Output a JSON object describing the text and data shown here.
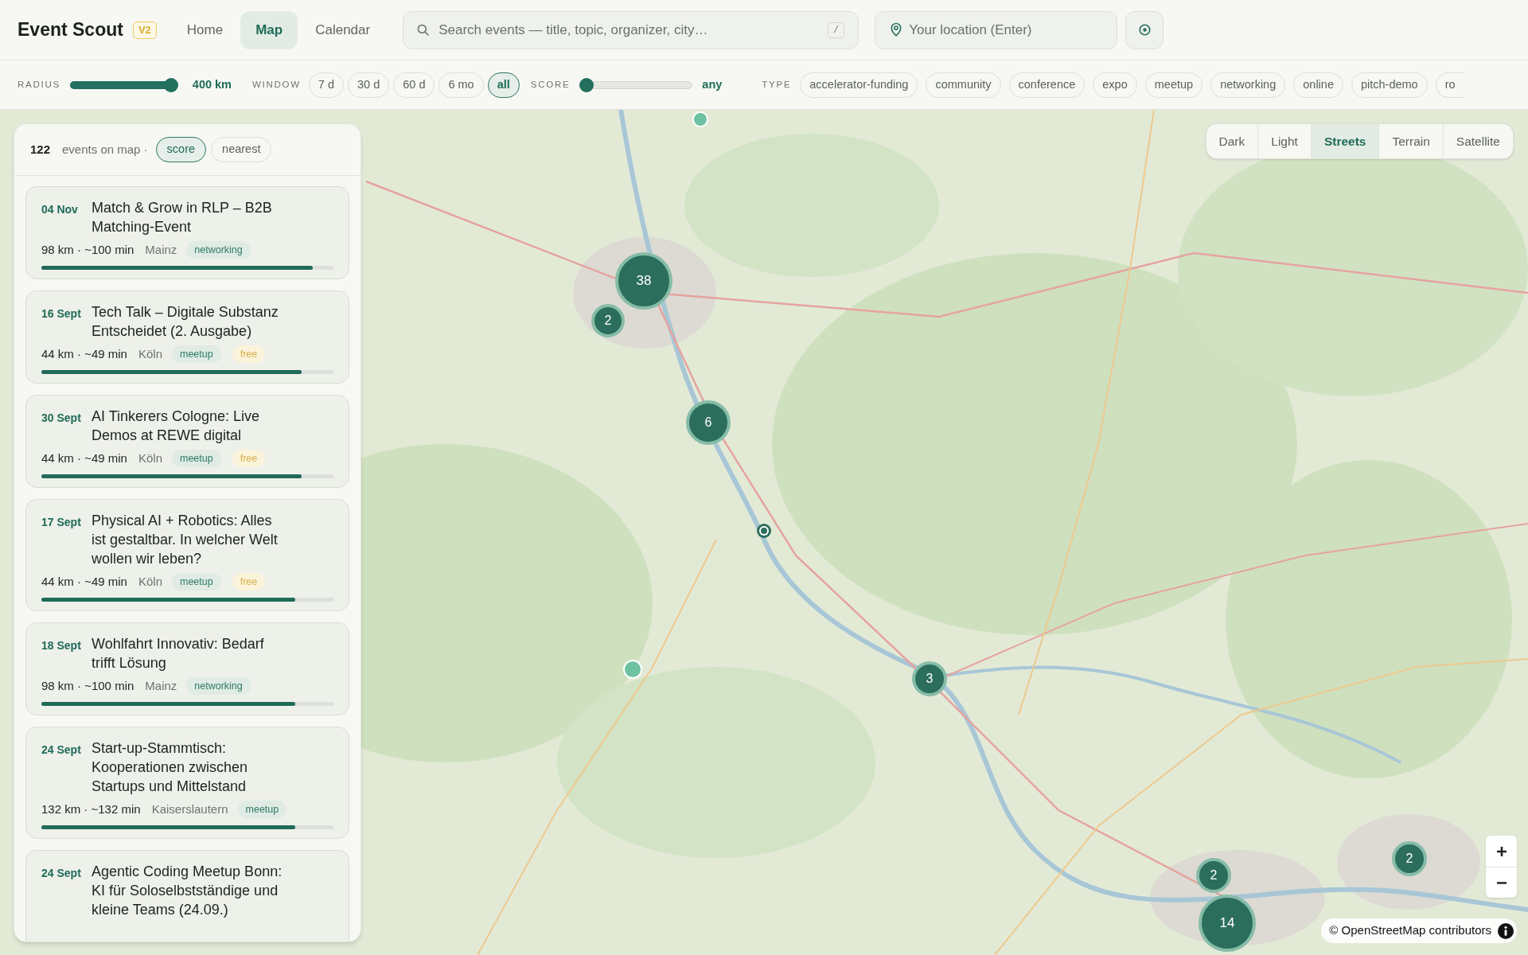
{
  "header": {
    "logo": "Event Scout",
    "badge": "V2",
    "nav": [
      {
        "label": "Home",
        "selected": false
      },
      {
        "label": "Map",
        "selected": true
      },
      {
        "label": "Calendar",
        "selected": false
      }
    ],
    "search": {
      "placeholder": "Search events — title, topic, organizer, city…",
      "shortcut": "/"
    },
    "location": {
      "placeholder": "Your location (Enter)"
    }
  },
  "filters": {
    "radius": {
      "label": "RADIUS",
      "level": 1,
      "reading": "400 km"
    },
    "window": {
      "label": "WINDOW",
      "options": [
        {
          "label": "7 d",
          "selected": false
        },
        {
          "label": "30 d",
          "selected": false
        },
        {
          "label": "60 d",
          "selected": false
        },
        {
          "label": "6 mo",
          "selected": false
        },
        {
          "label": "all",
          "selected": true
        }
      ]
    },
    "score": {
      "label": "SCORE",
      "level": 0,
      "reading": "any"
    },
    "type": {
      "label": "TYPE",
      "options": [
        {
          "label": "accelerator-funding",
          "selected": false
        },
        {
          "label": "community",
          "selected": false
        },
        {
          "label": "conference",
          "selected": false
        },
        {
          "label": "expo",
          "selected": false
        },
        {
          "label": "meetup",
          "selected": false
        },
        {
          "label": "networking",
          "selected": false
        },
        {
          "label": "online",
          "selected": false
        },
        {
          "label": "pitch-demo",
          "selected": false
        },
        {
          "label": "ro",
          "selected": false
        }
      ]
    }
  },
  "sidebar": {
    "count": "122",
    "label": "events on map ·",
    "sort": [
      {
        "label": "score",
        "selected": true
      },
      {
        "label": "nearest",
        "selected": false
      }
    ],
    "events": [
      {
        "date": "04 Nov",
        "title": "Match & Grow in RLP – B2B Matching-Event",
        "distance": "98 km · ~100 min",
        "city": "Mainz",
        "tags": [
          {
            "label": "networking",
            "kind": "category"
          }
        ],
        "level": 0.93
      },
      {
        "date": "16 Sept",
        "title": "Tech Talk – Digitale Substanz Entscheidet (2. Ausgabe)",
        "distance": "44 km · ~49 min",
        "city": "Köln",
        "tags": [
          {
            "label": "meetup",
            "kind": "category"
          },
          {
            "label": "free",
            "kind": "price"
          }
        ],
        "level": 0.89
      },
      {
        "date": "30 Sept",
        "title": "AI Tinkerers Cologne: Live Demos at REWE digital",
        "distance": "44 km · ~49 min",
        "city": "Köln",
        "tags": [
          {
            "label": "meetup",
            "kind": "category"
          },
          {
            "label": "free",
            "kind": "price"
          }
        ],
        "level": 0.89
      },
      {
        "date": "17 Sept",
        "title": "Physical AI + Robotics: Alles ist gestaltbar. In welcher Welt wollen wir leben?",
        "distance": "44 km · ~49 min",
        "city": "Köln",
        "tags": [
          {
            "label": "meetup",
            "kind": "category"
          },
          {
            "label": "free",
            "kind": "price"
          }
        ],
        "level": 0.87
      },
      {
        "date": "18 Sept",
        "title": "Wohlfahrt Innovativ: Bedarf trifft Lösung",
        "distance": "98 km · ~100 min",
        "city": "Mainz",
        "tags": [
          {
            "label": "networking",
            "kind": "category"
          }
        ],
        "level": 0.87
      },
      {
        "date": "24 Sept",
        "title": "Start-up-Stammtisch: Kooperationen zwischen Startups und Mittelstand",
        "distance": "132 km · ~132 min",
        "city": "Kaiserslautern",
        "tags": [
          {
            "label": "meetup",
            "kind": "category"
          }
        ],
        "level": 0.87
      },
      {
        "date": "24 Sept",
        "title": "Agentic Coding Meetup Bonn: KI für Soloselbstständige und kleine Teams (24.09.)"
      }
    ]
  },
  "map": {
    "styles": [
      {
        "label": "Dark",
        "selected": false
      },
      {
        "label": "Light",
        "selected": false
      },
      {
        "label": "Streets",
        "selected": true
      },
      {
        "label": "Terrain",
        "selected": false
      },
      {
        "label": "Satellite",
        "selected": false
      }
    ],
    "clusters": [
      {
        "count": "38"
      },
      {
        "count": "2"
      },
      {
        "count": "6"
      },
      {
        "count": "3"
      },
      {
        "count": "2"
      },
      {
        "count": "2"
      },
      {
        "count": "14"
      }
    ],
    "attribution": "© OpenStreetMap contributors"
  }
}
